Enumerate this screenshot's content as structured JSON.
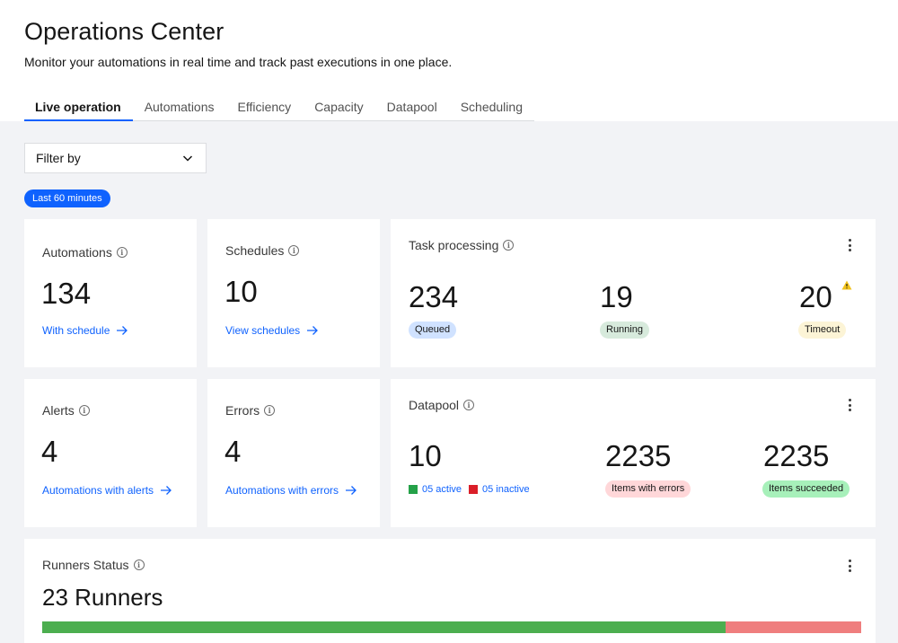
{
  "header": {
    "title": "Operations Center",
    "subtitle": "Monitor your automations in real time and track past executions in one place."
  },
  "tabs": [
    {
      "label": "Live operation",
      "active": true
    },
    {
      "label": "Automations"
    },
    {
      "label": "Efficiency"
    },
    {
      "label": "Capacity"
    },
    {
      "label": "Datapool"
    },
    {
      "label": "Scheduling"
    }
  ],
  "filter": {
    "label": "Filter by"
  },
  "time_chip": "Last 60 minutes",
  "cards": {
    "automations": {
      "title": "Automations",
      "value": "134",
      "link": "With schedule"
    },
    "schedules": {
      "title": "Schedules",
      "value": "10",
      "link": "View schedules"
    },
    "alerts": {
      "title": "Alerts",
      "value": "4",
      "link": "Automations with alerts"
    },
    "errors": {
      "title": "Errors",
      "value": "4",
      "link": "Automations with errors"
    },
    "task_processing": {
      "title": "Task processing",
      "queued": {
        "value": "234",
        "label": "Queued"
      },
      "running": {
        "value": "19",
        "label": "Running"
      },
      "timeout": {
        "value": "20",
        "label": "Timeout"
      }
    },
    "datapool": {
      "title": "Datapool",
      "count": "10",
      "active": "05 active",
      "inactive": "05 inactive",
      "errors": {
        "value": "2235",
        "label": "Items with errors"
      },
      "succeeded": {
        "value": "2235",
        "label": "Items succeeded"
      }
    },
    "runners": {
      "title": "Runners Status",
      "value": "23 Runners",
      "ok_fraction": 0.834
    }
  },
  "colors": {
    "accent": "#0f62fe",
    "queued_bg": "#d0e2ff",
    "running_bg": "#d7eadc",
    "timeout_bg": "#fcf4d6",
    "error_bg": "#ffd7d9",
    "success_bg": "#a7f0ba",
    "active": "#24a148",
    "inactive": "#da1e28"
  },
  "icons": {
    "info": "information-icon",
    "arrow": "arrow-right-icon",
    "kebab": "overflow-menu-icon",
    "warning": "warning-triangle-icon",
    "chevron": "chevron-down-icon"
  }
}
